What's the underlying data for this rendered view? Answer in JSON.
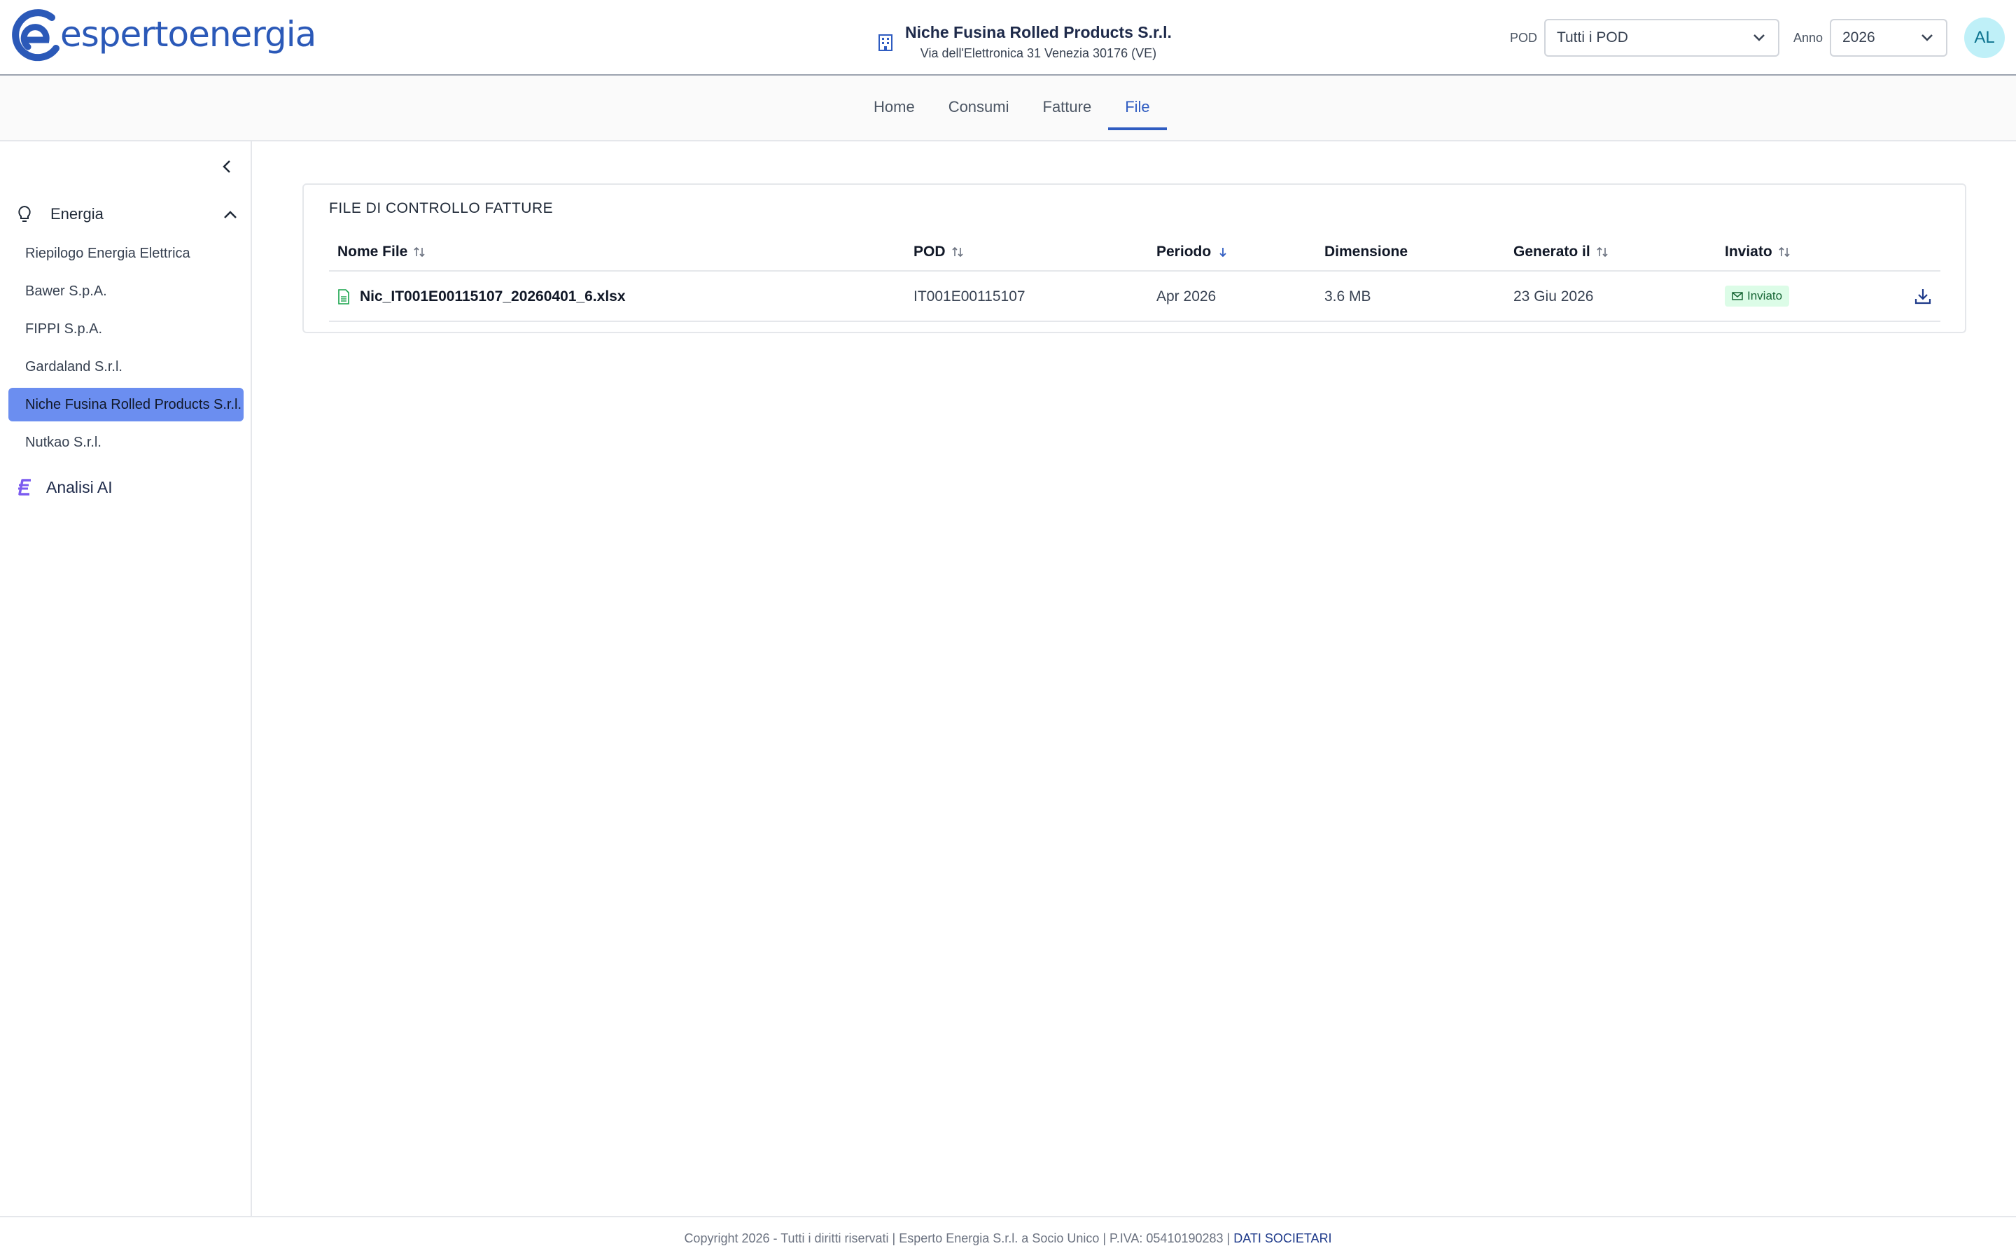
{
  "brand": {
    "name": "espertoenergia"
  },
  "header": {
    "company_name": "Niche Fusina Rolled Products S.r.l.",
    "company_address": "Via dell'Elettronica 31 Venezia 30176 (VE)",
    "pod_label": "POD",
    "pod_value": "Tutti i POD",
    "year_label": "Anno",
    "year_value": "2026",
    "avatar_initials": "AL"
  },
  "nav": {
    "tabs": [
      {
        "label": "Home",
        "active": false
      },
      {
        "label": "Consumi",
        "active": false
      },
      {
        "label": "Fatture",
        "active": false
      },
      {
        "label": "File",
        "active": true
      }
    ]
  },
  "sidebar": {
    "section_title": "Energia",
    "items": [
      {
        "label": "Riepilogo Energia Elettrica",
        "active": false
      },
      {
        "label": "Bawer S.p.A.",
        "active": false
      },
      {
        "label": "FIPPI S.p.A.",
        "active": false
      },
      {
        "label": "Gardaland S.r.l.",
        "active": false
      },
      {
        "label": "Niche Fusina Rolled Products S.r.l.",
        "active": true
      },
      {
        "label": "Nutkao S.r.l.",
        "active": false
      }
    ],
    "ai_label": "Analisi AI"
  },
  "main": {
    "card_title": "FILE DI CONTROLLO FATTURE",
    "columns": [
      "Nome File",
      "POD",
      "Periodo",
      "Dimensione",
      "Generato il",
      "Inviato"
    ],
    "rows": [
      {
        "file_name": "Nic_IT001E00115107_20260401_6.xlsx",
        "pod": "IT001E00115107",
        "period": "Apr 2026",
        "size": "3.6 MB",
        "generated": "23 Giu 2026",
        "status": "Inviato"
      }
    ]
  },
  "footer": {
    "text": "Copyright 2026 - Tutti i diritti riservati | Esperto Energia S.r.l. a Socio Unico | P.IVA: 05410190283 | ",
    "link": "DATI SOCIETARI"
  },
  "colors": {
    "brand_blue": "#2b59b8",
    "active_tab": "#2f5cc1",
    "sidebar_active": "#6b8ef0",
    "badge_bg": "#dcfce7",
    "badge_text": "#166534",
    "ai_purple": "#7c5cf0"
  },
  "icons": [
    "logo-icon",
    "building-icon",
    "chevron-down-icon",
    "chevron-left-icon",
    "bulb-icon",
    "chevron-up-icon",
    "ai-logo-icon",
    "sort-icon",
    "sort-down-icon",
    "file-xlsx-icon",
    "mail-icon",
    "download-icon"
  ]
}
